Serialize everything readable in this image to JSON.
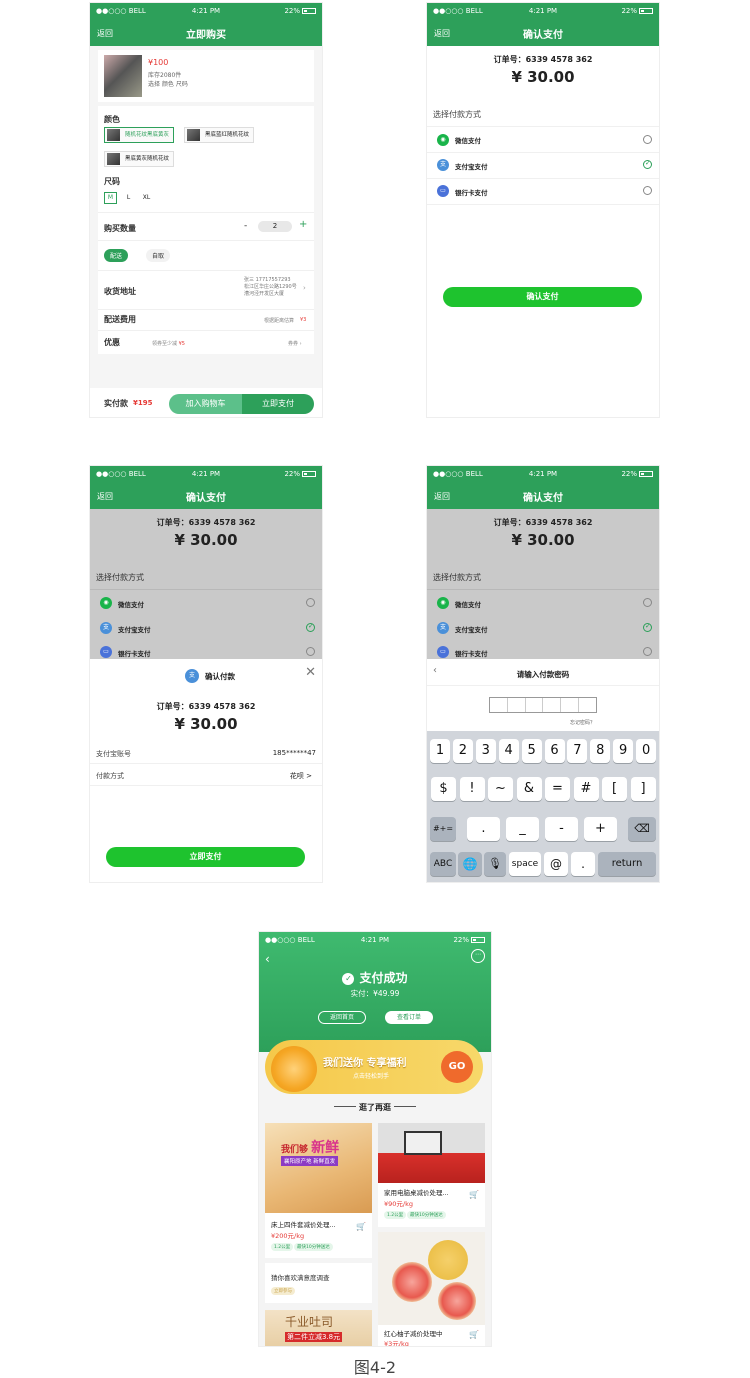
{
  "status": {
    "carrier": "●●○○○ BELL",
    "time": "4:21 PM",
    "battery": "22%"
  },
  "screen1": {
    "back": "返回",
    "title": "立即购买",
    "product": {
      "price": "¥100",
      "stock": "库存2080件",
      "choose": "选择 颜色 尺码"
    },
    "color_label": "颜色",
    "colors": [
      "随机花纹黑底黄灰",
      "黑底蓝红随机花纹",
      "黑底黄灰随机花纹"
    ],
    "size_label": "尺码",
    "sizes": [
      "M",
      "L",
      "XL"
    ],
    "qty_label": "购买数量",
    "qty_minus": "-",
    "qty_value": "2",
    "qty_plus": "+",
    "delivery_opts": [
      "配送",
      "自取"
    ],
    "address_label": "收货地址",
    "address_lines": [
      "张三  17717557293",
      "松江区华庄公路1290号",
      "漕河泾开发区大厦"
    ],
    "fee_label": "配送费用",
    "fee_note": "根据距离估算",
    "fee_value": "¥3",
    "discount_label": "优惠",
    "discount_note": "领券至少减",
    "discount_value": "¥5",
    "discount_right": "券券",
    "pay_label": "实付款",
    "pay_value": "¥195",
    "add_cart": "加入购物车",
    "buy_now": "立即支付"
  },
  "screen2": {
    "back": "返回",
    "title": "确认支付",
    "order_no": "订单号：6339 4578 362",
    "amount": "¥ 30.00",
    "choose_label": "选择付款方式",
    "methods": [
      "微信支付",
      "支付宝支付",
      "银行卡支付"
    ],
    "confirm": "确认支付"
  },
  "screen3": {
    "back": "返回",
    "title": "确认支付",
    "order_no": "订单号：6339 4578 362",
    "amount": "¥ 30.00",
    "choose_label": "选择付款方式",
    "methods": [
      "微信支付",
      "支付宝支付",
      "银行卡支付"
    ],
    "sheet_title": "确认付款",
    "sheet_order": "订单号：6339 4578 362",
    "sheet_amount": "¥ 30.00",
    "account_label": "支付宝账号",
    "account_value": "185******47",
    "method_label": "付款方式",
    "method_value": "花呗 >",
    "pay_now": "立即支付"
  },
  "screen4": {
    "back": "返回",
    "title": "确认支付",
    "order_no": "订单号：6339 4578 362",
    "amount": "¥ 30.00",
    "choose_label": "选择付款方式",
    "methods": [
      "微信支付",
      "支付宝支付",
      "银行卡支付"
    ],
    "pwd_title": "请输入付款密码",
    "forgot": "忘记密码？",
    "row1": [
      "1",
      "2",
      "3",
      "4",
      "5",
      "6",
      "7",
      "8",
      "9",
      "0"
    ],
    "row2": [
      "$",
      "!",
      "~",
      "&",
      "=",
      "#",
      "[",
      "]"
    ],
    "row3": [
      "#+=",
      ".",
      "_",
      "-",
      "+"
    ],
    "row4": [
      "ABC",
      "space",
      "@",
      ".",
      "return"
    ]
  },
  "screen5": {
    "success": "支付成功",
    "paid": "实付：¥49.99",
    "home_btn": "返回首页",
    "order_btn": "查看订单",
    "banner_title": "我们送你  专享福利",
    "banner_sub": "点击轻松到手",
    "banner_go": "GO",
    "section": "逛了再逛",
    "p1_ad1": "我们够",
    "p1_ad2": "新鲜",
    "p1_ad3": "襄阳原产地 新鲜直发",
    "p1_name": "床上四件套减价处理...",
    "p1_price": "¥200元/kg",
    "p1_tags": [
      "1.2公里",
      "最快10分钟送达"
    ],
    "p2_name": "家用电脑桌减价处理...",
    "p2_price": "¥90元/kg",
    "p2_tags": [
      "1.2公里",
      "最快10分钟送达"
    ],
    "survey": "猜你喜欢满意度调查",
    "survey_tag": "立即参与",
    "p3_ad1": "千业吐司",
    "p3_ad2": "第二件立减3.8元",
    "p4_name": "红心柚子减价处理中",
    "p4_price": "¥3元/kg"
  },
  "caption": "图4-2"
}
